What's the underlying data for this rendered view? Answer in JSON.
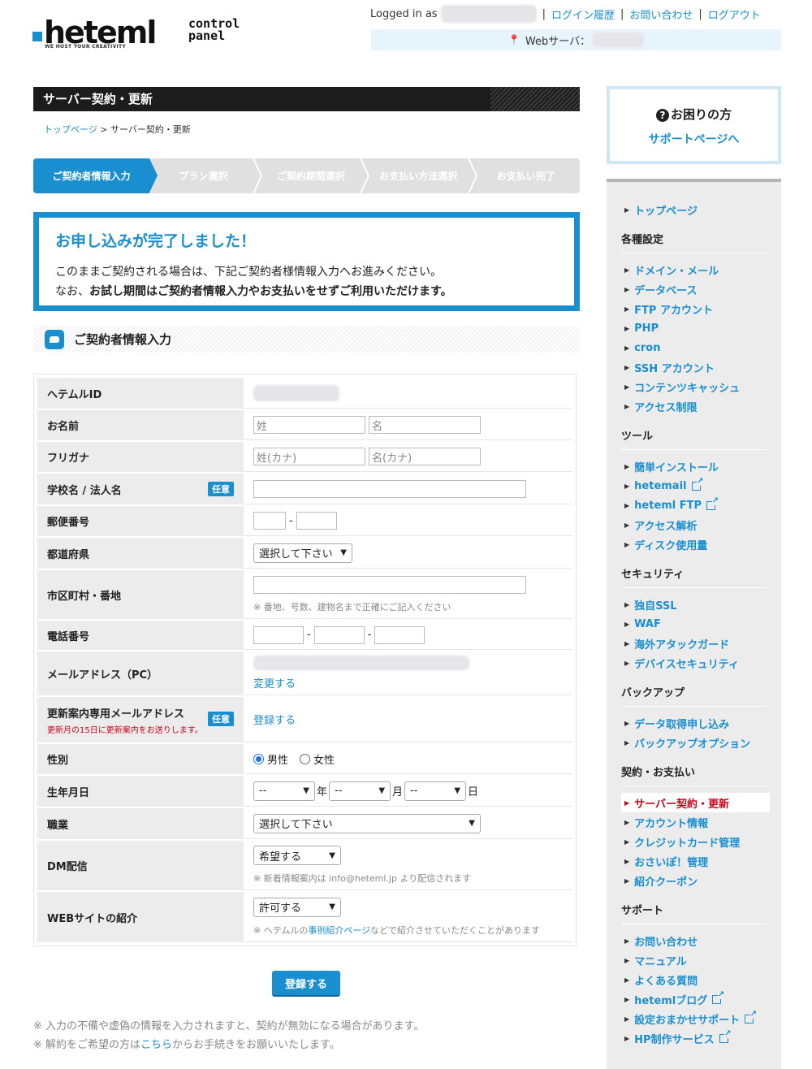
{
  "header": {
    "logo_main": "heteml",
    "logo_side": "control panel",
    "logo_tagline": "WE HOST YOUR CREATIVITY",
    "logged_in_label": "Logged in as",
    "nav": [
      "ログイン履歴",
      "お問い合わせ",
      "ログアウト"
    ],
    "server_label": "Webサーバ："
  },
  "page": {
    "title": "サーバー契約・更新",
    "breadcrumb_home": "トップページ",
    "breadcrumb_sep": " > ",
    "breadcrumb_current": "サーバー契約・更新"
  },
  "steps": [
    "ご契約者情報入力",
    "プラン選択",
    "ご契約期間選択",
    "お支払い方法選択",
    "お支払い完了"
  ],
  "notice": {
    "title": "お申し込みが完了しました！",
    "line1": "このままご契約される場合は、下記ご契約者様情報入力へお進みください。",
    "line2_prefix": "なお、",
    "line2_bold": "お試し期間はご契約者情報入力やお支払いをせずご利用いただけます。"
  },
  "section_title": "ご契約者情報入力",
  "form": {
    "optional_badge": "任意",
    "heteml_id": "ヘテムルID",
    "name": "お名前",
    "name_last_ph": "姓",
    "name_first_ph": "名",
    "furigana": "フリガナ",
    "kana_last_ph": "姓(カナ)",
    "kana_first_ph": "名(カナ)",
    "school": "学校名 / 法人名",
    "postal": "郵便番号",
    "dash": "-",
    "prefecture": "都道府県",
    "prefecture_value": "選択して下さい",
    "address": "市区町村・番地",
    "address_hint": "※ 番地、号数、建物名まで正確にご記入ください",
    "phone": "電話番号",
    "email_pc": "メールアドレス（PC）",
    "email_change": "変更する",
    "renewal_email": "更新案内専用メールアドレス",
    "renewal_note": "更新月の15日に更新案内をお送りします。",
    "renewal_register": "登録する",
    "gender": "性別",
    "male": "男性",
    "female": "女性",
    "birth": "生年月日",
    "birth_placeholder": "--",
    "year": "年",
    "month": "月",
    "day": "日",
    "job": "職業",
    "job_value": "選択して下さい",
    "dm": "DM配信",
    "dm_value": "希望する",
    "dm_hint": "※ 新着情報案内は info@heteml.jp より配信されます",
    "web": "WEBサイトの紹介",
    "web_value": "許可する",
    "web_hint_prefix": "※ ヘテムルの",
    "web_hint_link": "事例紹介ページ",
    "web_hint_suffix": "などで紹介させていただくことがあります"
  },
  "submit_label": "登録する",
  "footnotes": {
    "note1": "※ 入力の不備や虚偽の情報を入力されますと、契約が無効になる場合があります。",
    "note2_prefix": "※ 解約をご希望の方は",
    "note2_link": "こちら",
    "note2_suffix": "からお手続きをお願いいたします。"
  },
  "help_box": {
    "title": "お困りの方",
    "link": "サポートページへ"
  },
  "sidebar": {
    "top": "トップページ",
    "sections": [
      {
        "title": "各種設定",
        "items": [
          "ドメイン・メール",
          "データベース",
          "FTP アカウント",
          "PHP",
          "cron",
          "SSH アカウント",
          "コンテンツキャッシュ",
          "アクセス制限"
        ]
      },
      {
        "title": "ツール",
        "items": [
          "簡単インストール",
          "hetemail",
          "heteml FTP",
          "アクセス解析",
          "ディスク使用量"
        ]
      },
      {
        "title": "セキュリティ",
        "items": [
          "独自SSL",
          "WAF",
          "海外アタックガード",
          "デバイスセキュリティ"
        ]
      },
      {
        "title": "バックアップ",
        "items": [
          "データ取得申し込み",
          "バックアップオプション"
        ]
      },
      {
        "title": "契約・お支払い",
        "items": [
          "サーバー契約・更新",
          "アカウント情報",
          "クレジットカード管理",
          "おさいぽ！管理",
          "紹介クーポン"
        ]
      },
      {
        "title": "サポート",
        "items": [
          "お問い合わせ",
          "マニュアル",
          "よくある質問",
          "hetemlブログ",
          "設定おまかせサポート",
          "HP制作サービス"
        ]
      }
    ]
  },
  "colors": {
    "accent": "#1a8fcf",
    "active": "#d0021b",
    "dark": "#1c1c1c"
  }
}
